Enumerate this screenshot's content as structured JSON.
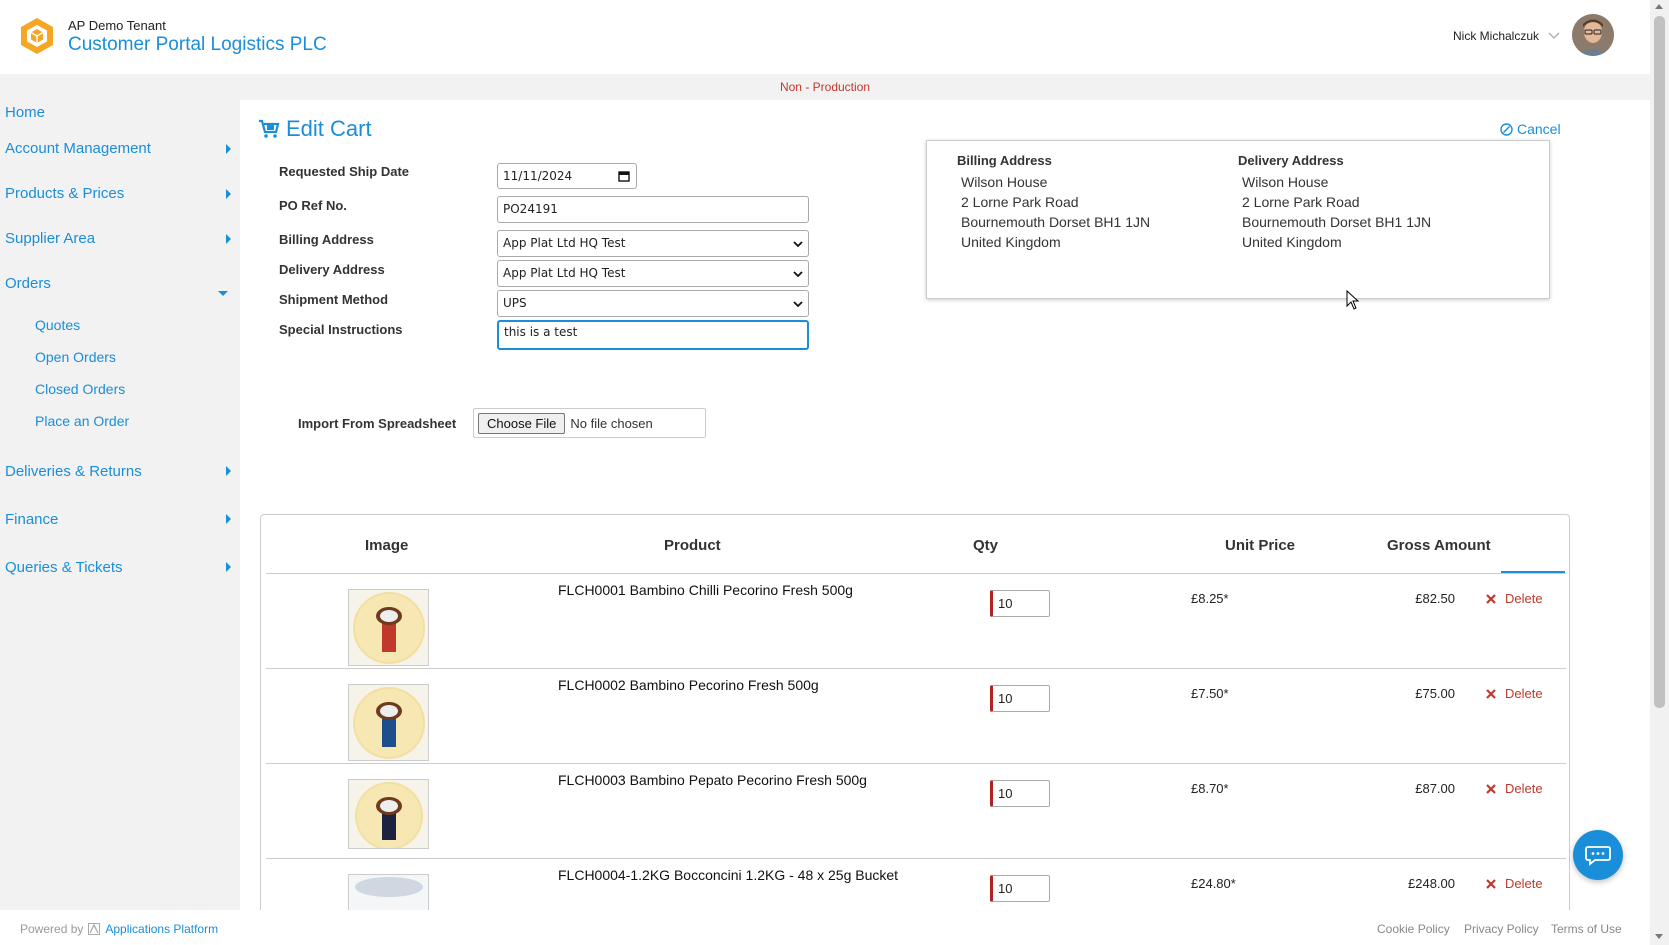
{
  "header": {
    "tenant": "AP Demo Tenant",
    "portal_title": "Customer Portal Logistics PLC",
    "user_name": "Nick Michalczuk"
  },
  "environment_banner": "Non - Production",
  "sidebar": {
    "items": [
      {
        "label": "Home"
      },
      {
        "label": "Account Management"
      },
      {
        "label": "Products & Prices"
      },
      {
        "label": "Supplier Area"
      },
      {
        "label": "Orders"
      },
      {
        "label": "Deliveries & Returns"
      },
      {
        "label": "Finance"
      },
      {
        "label": "Queries & Tickets"
      }
    ],
    "orders_sub": [
      {
        "label": "Quotes"
      },
      {
        "label": "Open Orders"
      },
      {
        "label": "Closed Orders"
      },
      {
        "label": "Place an Order"
      }
    ]
  },
  "page": {
    "title": "Edit Cart",
    "cancel_label": "Cancel"
  },
  "form": {
    "requested_ship_date": {
      "label": "Requested Ship Date",
      "value": "11/11/2024"
    },
    "po_ref": {
      "label": "PO Ref No.",
      "value": "PO24191"
    },
    "billing_address": {
      "label": "Billing Address",
      "value": "App Plat Ltd HQ Test"
    },
    "delivery_address": {
      "label": "Delivery Address",
      "value": "App Plat Ltd HQ Test"
    },
    "shipment_method": {
      "label": "Shipment Method",
      "value": "UPS"
    },
    "special_instructions": {
      "label": "Special Instructions",
      "value": "this is a test"
    }
  },
  "address_panel": {
    "billing": {
      "heading": "Billing Address",
      "lines": [
        "Wilson House",
        "2 Lorne Park Road",
        "Bournemouth Dorset BH1 1JN",
        "United Kingdom"
      ]
    },
    "delivery": {
      "heading": "Delivery Address",
      "lines": [
        "Wilson House",
        "2 Lorne Park Road",
        "Bournemouth Dorset BH1 1JN",
        "United Kingdom"
      ]
    }
  },
  "import": {
    "label": "Import From Spreadsheet",
    "button_label": "Choose File",
    "status": "No file chosen"
  },
  "cart": {
    "headers": {
      "image": "Image",
      "product": "Product",
      "qty": "Qty",
      "unit_price": "Unit Price",
      "gross_amount": "Gross Amount"
    },
    "delete_label": "Delete",
    "rows": [
      {
        "product": "FLCH0001 Bambino Chilli Pecorino Fresh 500g",
        "qty": "10",
        "unit_price": "£8.25*",
        "gross": "£82.50",
        "label_color": "#c0392b"
      },
      {
        "product": "FLCH0002 Bambino Pecorino Fresh 500g",
        "qty": "10",
        "unit_price": "£7.50*",
        "gross": "£75.00",
        "label_color": "#1f4e8c"
      },
      {
        "product": "FLCH0003 Bambino Pepato Pecorino Fresh 500g",
        "qty": "10",
        "unit_price": "£8.70*",
        "gross": "£87.00",
        "label_color": "#1b2340"
      },
      {
        "product": "FLCH0004-1.2KG Bocconcini 1.2KG - 48 x 25g Bucket",
        "qty": "10",
        "unit_price": "£24.80*",
        "gross": "£248.00",
        "label_color": "#cfd8e0"
      }
    ]
  },
  "footer": {
    "powered_by": "Powered by",
    "brand": "Applications Platform",
    "links": [
      "Cookie Policy",
      "Privacy Policy",
      "Terms of Use"
    ]
  },
  "colors": {
    "accent": "#1a8ed8",
    "brand_logo": "#f5a623",
    "danger": "#c0392b"
  }
}
